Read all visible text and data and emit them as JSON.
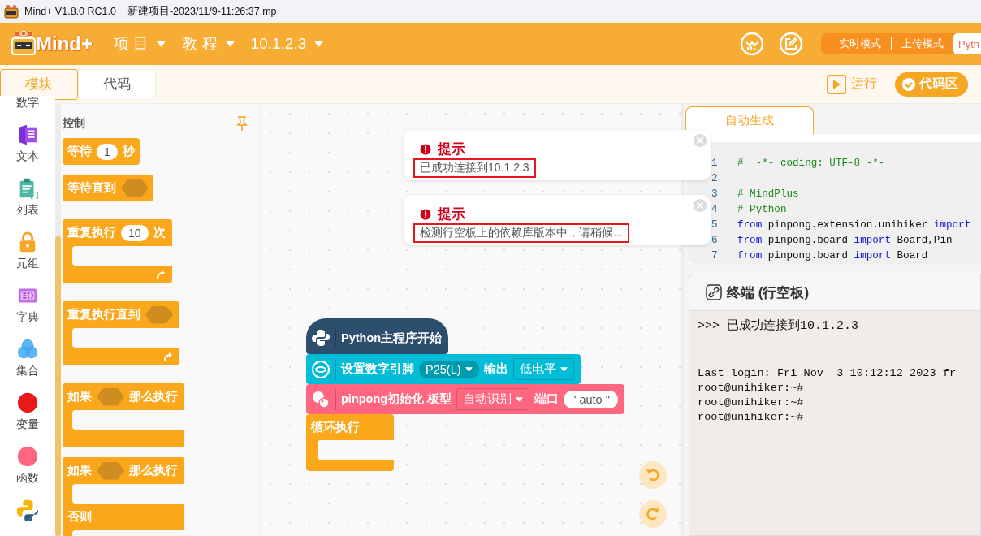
{
  "title_bar": {
    "title": "Mind+ V1.8.0 RC1.0",
    "file": "新建项目-2023/11/9-11:26:37.mp"
  },
  "header": {
    "logo": "Mind+",
    "menus": [
      {
        "label": "项 目"
      },
      {
        "label": "教 程"
      },
      {
        "label": "10.1.2.3"
      }
    ],
    "modes": [
      {
        "label": "实时模式",
        "selected": false
      },
      {
        "label": "上传模式",
        "selected": false
      },
      {
        "label": "Pyth",
        "selected": true
      }
    ]
  },
  "view_tabs": [
    {
      "label": "模块",
      "selected": true
    },
    {
      "label": "代码",
      "selected": false
    }
  ],
  "run_button": "运行",
  "code_area_button": "代码区",
  "categories": [
    {
      "label": "数字"
    },
    {
      "kind": "text",
      "label": "文本"
    },
    {
      "kind": "list",
      "label": "列表"
    },
    {
      "kind": "tuple",
      "label": "元组"
    },
    {
      "kind": "dict",
      "label": "字典"
    },
    {
      "kind": "set",
      "label": "集合"
    },
    {
      "kind": "dot",
      "color": "#e8191b",
      "label": "变量"
    },
    {
      "kind": "dot",
      "color": "#ff6680",
      "label": "函数"
    },
    {
      "kind": "python"
    }
  ],
  "palette": {
    "title": "控制",
    "blocks": [
      {
        "kind": "command",
        "parts": [
          {
            "kind": "text",
            "text": "等待"
          },
          {
            "kind": "number",
            "text": "1"
          },
          {
            "kind": "text",
            "text": "秒"
          }
        ]
      },
      {
        "kind": "command",
        "parts": [
          {
            "kind": "text",
            "text": "等待直到"
          },
          {
            "kind": "slot"
          }
        ]
      },
      {
        "kind": "loop",
        "parts": [
          {
            "kind": "text",
            "text": "重复执行"
          },
          {
            "kind": "number",
            "text": "10"
          },
          {
            "kind": "text",
            "text": "次"
          }
        ]
      },
      {
        "kind": "loop",
        "parts": [
          {
            "kind": "text",
            "text": "重复执行直到"
          },
          {
            "kind": "slot"
          }
        ]
      },
      {
        "kind": "if",
        "parts": [
          {
            "kind": "text",
            "text": "如果"
          },
          {
            "kind": "slot"
          },
          {
            "kind": "text",
            "text": "那么执行"
          }
        ]
      },
      {
        "kind": "ifelse",
        "parts": [
          {
            "kind": "text",
            "text": "如果"
          },
          {
            "kind": "slot"
          },
          {
            "kind": "text",
            "text": "那么执行"
          }
        ],
        "else_label": "否则"
      }
    ]
  },
  "notifications": [
    {
      "title": "提示",
      "message": "已成功连接到10.1.2.3",
      "highlighted": true
    },
    {
      "title": "提示",
      "message": "检测行空板上的依赖库版本中，请稍候...",
      "highlighted": true
    }
  ],
  "script": [
    {
      "kind": "hat",
      "color": "#2e4e6d",
      "parts": [
        {
          "kind": "text",
          "text": "Python主程序开始"
        }
      ]
    },
    {
      "kind": "pin",
      "color": "#00bcd6",
      "parts": [
        {
          "kind": "text",
          "text": "设置数字引脚"
        },
        {
          "kind": "pill-menu",
          "text": "P25(L)"
        },
        {
          "kind": "text",
          "text": "输出"
        },
        {
          "kind": "menu",
          "text": "低电平"
        }
      ]
    },
    {
      "kind": "pinpong",
      "color": "#ff6680",
      "parts": [
        {
          "kind": "text",
          "text": "pinpong初始化 板型"
        },
        {
          "kind": "menu",
          "text": "自动识别"
        },
        {
          "kind": "text",
          "text": "端口"
        },
        {
          "kind": "string",
          "text": "\" auto \""
        }
      ]
    },
    {
      "kind": "forever",
      "color": "#fba71b",
      "parts": [
        {
          "kind": "text",
          "text": "循环执行"
        }
      ]
    }
  ],
  "code_panel": {
    "tab": "自动生成",
    "lines": [
      {
        "n": "1",
        "tokens": [
          {
            "kind": "comment",
            "text": "#  -*- coding: UTF-8 -*-"
          }
        ]
      },
      {
        "n": "2"
      },
      {
        "n": "3",
        "tokens": [
          {
            "kind": "comment",
            "text": "# MindPlus"
          }
        ]
      },
      {
        "n": "4",
        "tokens": [
          {
            "kind": "comment",
            "text": "# Python"
          }
        ]
      },
      {
        "n": "5",
        "tokens": [
          {
            "kind": "keyword",
            "text": "from"
          },
          {
            "kind": "plain",
            "text": " pinpong.extension.unihiker "
          },
          {
            "kind": "keyword",
            "text": "import"
          }
        ]
      },
      {
        "n": "6",
        "tokens": [
          {
            "kind": "keyword",
            "text": "from"
          },
          {
            "kind": "plain",
            "text": " pinpong.board "
          },
          {
            "kind": "keyword",
            "text": "import"
          },
          {
            "kind": "plain",
            "text": " Board,Pin"
          }
        ]
      },
      {
        "n": "7",
        "tokens": [
          {
            "kind": "keyword",
            "text": "from"
          },
          {
            "kind": "plain",
            "text": " pinpong.board "
          },
          {
            "kind": "keyword",
            "text": "import"
          },
          {
            "kind": "plain",
            "text": " Board"
          }
        ]
      }
    ]
  },
  "terminal": {
    "title": "终端 (行空板)",
    "connect_message": ">>> 已成功连接到10.1.2.3",
    "log": [
      "Last login: Fri Nov  3 10:12:12 2023 fr",
      "root@unihiker:~#",
      "root@unihiker:~#",
      "root@unihiker:~#"
    ]
  }
}
